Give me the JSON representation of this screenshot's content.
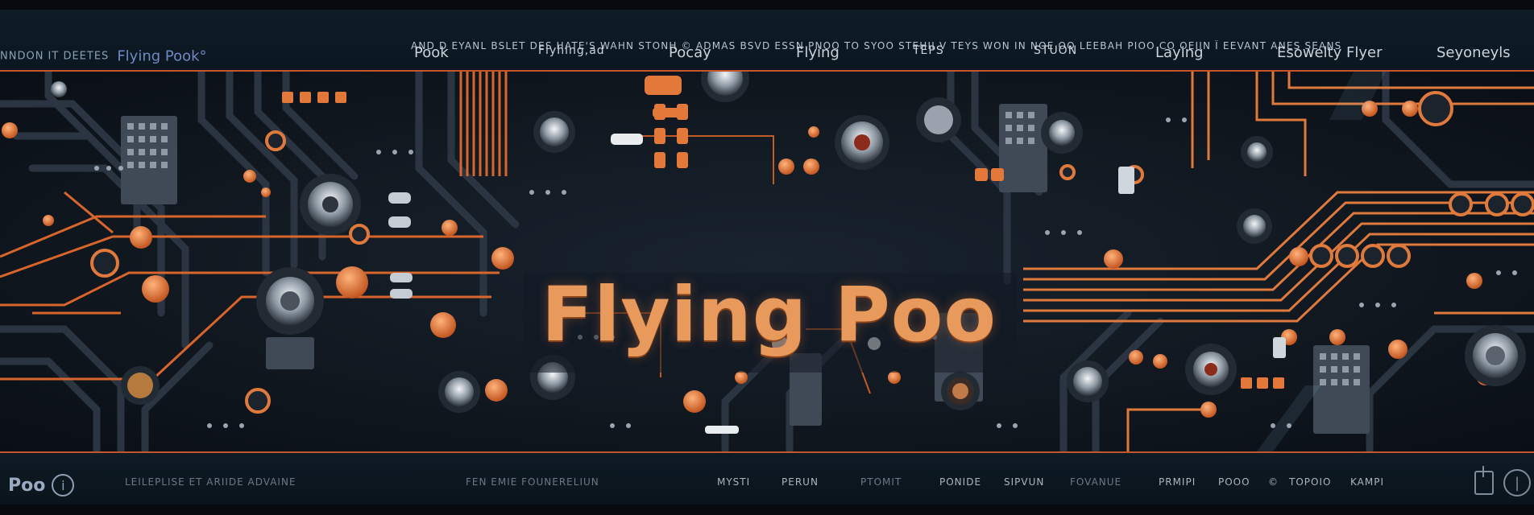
{
  "header": {
    "brand_prefix": "NNDON IT DEETES",
    "brand_name": "Flying Pook°",
    "microline": "AND D EYANL BSLET DES HATE'S WAHN STONH © ADMAS      BSVD ESSN  PNOO TO SYOO STEHII V TEYS        WON IN  NOE OO  LEEBAH  PIOO CO  OEIIN  Ï  EEVANT ANES SEANS",
    "nav": [
      {
        "label": "Pook",
        "size": "normal"
      },
      {
        "label": "Flyhing,ad",
        "size": "small"
      },
      {
        "label": "Pocay",
        "size": "normal"
      },
      {
        "label": "Flying",
        "size": "normal"
      },
      {
        "label": "TEPS",
        "size": "small"
      },
      {
        "label": "STUON",
        "size": "small"
      },
      {
        "label": "Laying",
        "size": "normal"
      },
      {
        "label": "Esowelty Flyer",
        "size": "normal"
      },
      {
        "label": "Seyoneyls",
        "size": "normal"
      }
    ]
  },
  "hero": {
    "title": "Flying Poo"
  },
  "footer": {
    "brand_name": "Poo",
    "info_icon": "info-icon",
    "items": [
      {
        "label": "LEILEPLISE ET ARIIDE ADVAINE",
        "tone": "dim"
      },
      {
        "label": "FEN  EMIE  FOUNERELIUN",
        "tone": "dim"
      },
      {
        "label": "MYSTI",
        "tone": "bright"
      },
      {
        "label": "PERUN",
        "tone": "bright"
      },
      {
        "label": "PTOMIT",
        "tone": "dim"
      },
      {
        "label": "PONIDE",
        "tone": "bright"
      },
      {
        "label": "SIPVUN",
        "tone": "bright"
      },
      {
        "label": "FOVANUE",
        "tone": "dim"
      },
      {
        "label": "PRMIPI",
        "tone": "bright"
      },
      {
        "label": "POOO",
        "tone": "bright"
      },
      {
        "label": "©",
        "tone": "bright"
      },
      {
        "label": "TOPOIO",
        "tone": "bright"
      },
      {
        "label": "KAMPI",
        "tone": "bright"
      }
    ],
    "icons": [
      "window-icon",
      "power-icon"
    ]
  },
  "colors": {
    "accent": "#e07a3c",
    "title": "#e79a5c",
    "board": "#10171f",
    "trace_dark": "#2b3541"
  }
}
